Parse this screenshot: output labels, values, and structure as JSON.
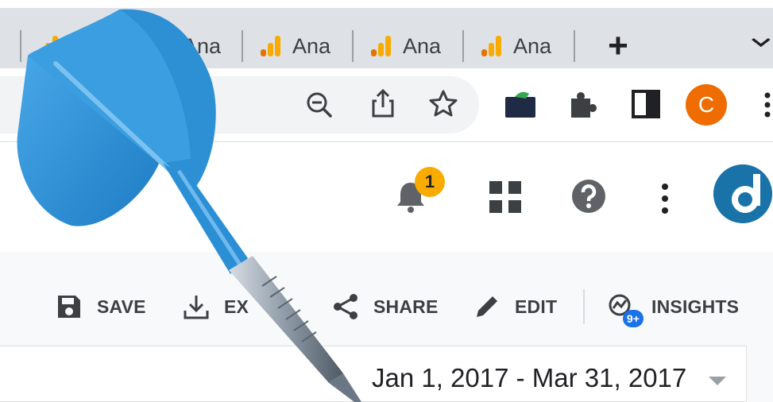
{
  "browser": {
    "tabs": [
      {
        "title": "An"
      },
      {
        "title": "Ana"
      },
      {
        "title": "Ana"
      },
      {
        "title": "Ana"
      },
      {
        "title": "Ana"
      }
    ],
    "new_tab_label": "+",
    "profile_initial": "C"
  },
  "header": {
    "notification_count": "1"
  },
  "report_toolbar": {
    "save_label": "SAVE",
    "export_label": "EX",
    "share_label": "SHARE",
    "edit_label": "EDIT",
    "insights_label": "INSIGHTS",
    "insights_badge": "9+"
  },
  "date_range": {
    "value": "Jan 1, 2017 - Mar 31, 2017"
  },
  "colors": {
    "tabstrip_bg": "#dee1e6",
    "ga_orange": "#f9ab00",
    "ga_dark_orange": "#e37400",
    "profile_orange": "#ef6c00",
    "notification_yellow": "#f9ab00",
    "insights_blue": "#1a73e8",
    "dart_blue": "#2b8fd6"
  },
  "icons": [
    "google-analytics-icon",
    "zoom-out-icon",
    "share-page-icon",
    "bookmark-star-icon",
    "extension-folder-icon",
    "puzzle-icon",
    "side-panel-icon",
    "bell-icon",
    "apps-grid-icon",
    "help-icon",
    "more-vert-icon",
    "save-icon",
    "download-icon",
    "share-icon",
    "pencil-icon",
    "insights-icon",
    "dart-overlay"
  ]
}
